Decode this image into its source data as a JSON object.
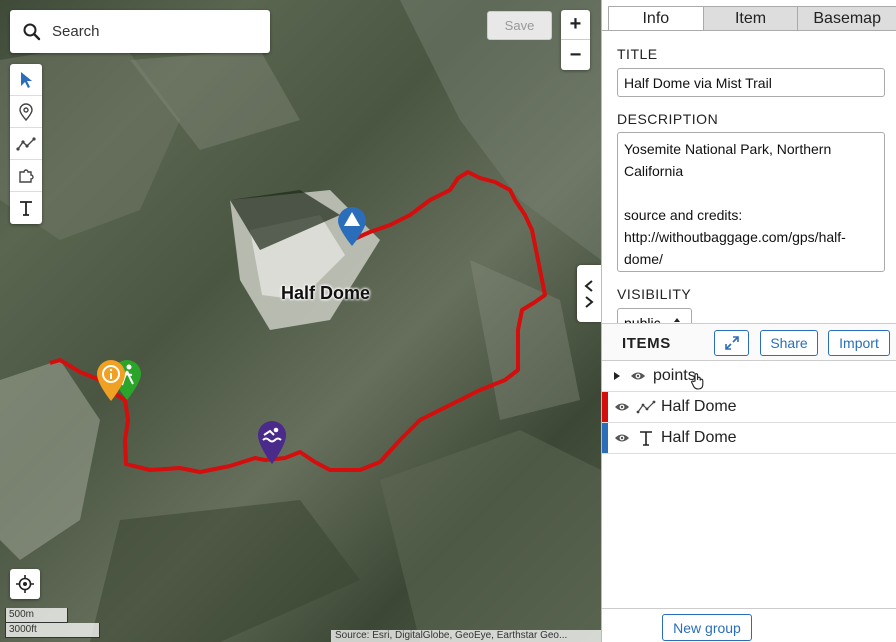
{
  "map": {
    "search_placeholder": "Search",
    "save_label": "Save",
    "zoom_in": "+",
    "zoom_out": "−",
    "place_label": "Half Dome",
    "scale_metric": "500m",
    "scale_imperial": "3000ft",
    "attribution": "Source: Esri, DigitalGlobe, GeoEye, Earthstar Geo...",
    "track_color": "#d40d0d",
    "markers": [
      "triangle-marker",
      "info-marker",
      "hiker-marker",
      "swimmer-marker"
    ]
  },
  "toolbar": {
    "tools": [
      "pointer-icon",
      "pin-icon",
      "line-icon",
      "puzzle-icon",
      "text-icon"
    ]
  },
  "sidebar": {
    "tabs": [
      "Info",
      "Item",
      "Basemap"
    ],
    "info": {
      "title_label": "TITLE",
      "title_value": "Half Dome via Mist Trail",
      "description_label": "DESCRIPTION",
      "description_value": "Yosemite National Park, Northern California\n\nsource and credits: http://withoutbaggage.com/gps/half-dome/",
      "visibility_label": "VISIBILITY",
      "visibility_value": "public"
    },
    "items": {
      "title": "ITEMS",
      "share_label": "Share",
      "import_label": "Import",
      "rows": [
        {
          "label": "points",
          "icon": "eye-icon",
          "color": ""
        },
        {
          "label": "Half Dome",
          "icon": "line-icon",
          "color": "#d40d0d"
        },
        {
          "label": "Half Dome",
          "icon": "text-icon",
          "color": "#2a6ebb"
        }
      ]
    },
    "new_group_label": "New group"
  }
}
